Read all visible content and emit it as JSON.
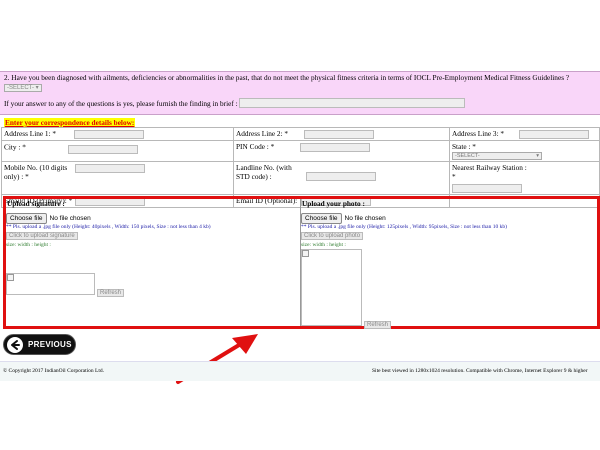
{
  "question": {
    "text": "2. Have you been diagnosed with ailments, deficiencies or abnormalities in the past, that do not meet the physical fitness criteria in terms of IOCL Pre-Employment Medical Fitness Guidelines ?",
    "select_value": "-SELECT-",
    "brief_label": "If your answer to any of the questions is yes, please furnish the finding in brief :",
    "brief_value": ""
  },
  "correspondence": {
    "heading": "Enter your correspondence details below:",
    "address_line_1": "Address Line 1: *",
    "address_line_2": "Address Line 2: *",
    "address_line_3": "Address Line 3: *",
    "city": "City : *",
    "pin_code": "PIN Code : *",
    "state": "State : *",
    "state_select": "-SELECT-",
    "mobile": "Mobile No. (10 digits only) : *",
    "landline": "Landline No. (with STD code) :",
    "railway": "Nearest Railway Station : *",
    "email_primary": "Emaild ID (Primary): *",
    "email_optional": "Email ID (Optional):"
  },
  "upload": {
    "signature": {
      "title": "Upload signature :",
      "choose": "Choose file",
      "no_file": "No file chosen",
      "hint": "** Pls. upload a .jpg file only (Height: 40pixels , Width: 150 pixels, Size : not less than 4 kb)",
      "upload_button": "Click to upload signature",
      "size_info": "size:   width :   height :",
      "refresh": "Refresh"
    },
    "photo": {
      "title": "Upload your photo :",
      "choose": "Choose file",
      "no_file": "No file chosen",
      "hint": "** Pls. upload a .jpg file only (Height: 125pixels , Width: 95pixels, Size : not less than 10 kb)",
      "upload_button": "Click to upload photo",
      "size_info": "size:   width :   height :",
      "refresh": "Refresh"
    }
  },
  "nav": {
    "previous": "PREVIOUS"
  },
  "footer": {
    "copyright": "© Copyright 2017 IndianOil Corporation Ltd.",
    "compat": "Site best viewed in 1280x1024 resolution. Compatible with Chrome, Internet Explorer 9 & higher"
  },
  "colors": {
    "question_bg": "#f9d6f9",
    "heading_text": "#e00000",
    "heading_bg": "#ffff00",
    "highlight_frame": "#e01010",
    "hint_text": "#1a1aa6"
  }
}
